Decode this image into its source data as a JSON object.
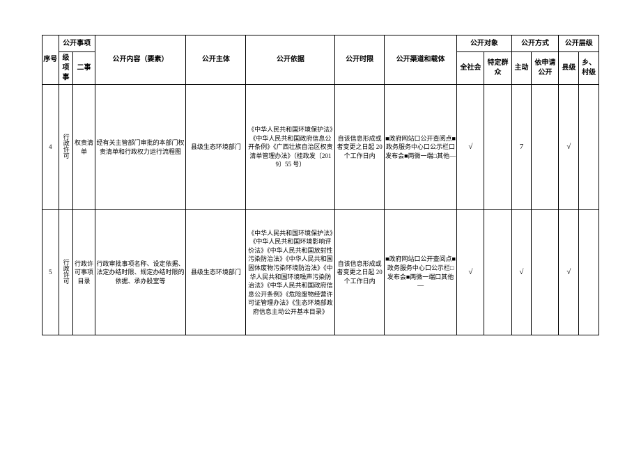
{
  "headers": {
    "seq": "序号",
    "matter_group": "公开事项",
    "l1": "级项事",
    "l2": "二事",
    "content": "公开内容（要素）",
    "subject": "公开主体",
    "basis": "公开依据",
    "time": "公开时限",
    "channel": "公开渠道和载体",
    "audience_group": "公开对象",
    "aud_all": "全社会",
    "aud_spec": "特定群众",
    "method_group": "公开方式",
    "m_active": "主动",
    "m_apply": "依申请公开",
    "level_group": "公开层级",
    "lv_county": "县级",
    "lv_village": "乡、村级"
  },
  "rows": [
    {
      "seq": "4",
      "l1": "行政许可",
      "l2": "权责清单",
      "content": "经有关主管部门审批的本部门权责清单和行政权力运行流程图",
      "subject": "县级生态环境部门",
      "basis": "《中华人民共和国环境保护法》《中华人民共和国政府信息公开条例》《广西壮族自治区权责清单管理办法》（桂政发〔2019〕55 号）",
      "time": "自该信息形成或者变更之日起 20 个工作日内",
      "channel": "■政府网站口公开查阅点■政务服务中心口公示栏口发布会■两微一端□其他—",
      "aud_all": "√",
      "aud_spec": "",
      "m_active": "7",
      "m_apply": "",
      "lv_county": "√",
      "lv_village": ""
    },
    {
      "seq": "5",
      "l1": "行政许可",
      "l2": "行政许可事项目录",
      "content": "行政审批事项名称、设定依据、法定办结时限、规定办结时限的依据、承办股室等",
      "subject": "县级生态环境部门",
      "basis": "《中华人民共和国环境保护法》《中华人民共和国环境影响评价法》《中华人民共和国放射性污染防治法》《中华人民共和国固体废物污染环境防治法》《中华人民共和国环境噪声污染防治法》《中华人民共和国政府信息公开条例》《危险废物经营许可证管理办法》《生态环境部政府信息主动公开基本目录》",
      "time": "自该信息形成或者变更之日起 20 个工作日内",
      "channel": "■政府网站口公开查阅点■政务服务中心口公示栏□发布会■两微一端口其他—",
      "aud_all": "√",
      "aud_spec": "",
      "m_active": "√",
      "m_apply": "",
      "lv_county": "√",
      "lv_village": ""
    }
  ]
}
